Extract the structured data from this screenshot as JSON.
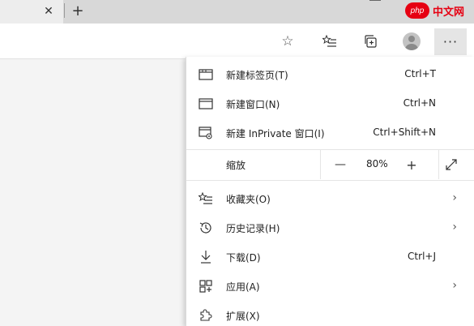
{
  "tabstrip": {
    "close_glyph": "✕",
    "newtab_glyph": "+"
  },
  "watermark": {
    "badge": "php",
    "text": "中文网"
  },
  "toolbar": {
    "more_glyph": "···",
    "star_glyph": "☆"
  },
  "menu": {
    "items": [
      {
        "label": "新建标签页(T)",
        "shortcut": "Ctrl+T",
        "icon": "new-tab-icon"
      },
      {
        "label": "新建窗口(N)",
        "shortcut": "Ctrl+N",
        "icon": "new-window-icon"
      },
      {
        "label": "新建 InPrivate 窗口(I)",
        "shortcut": "Ctrl+Shift+N",
        "icon": "inprivate-window-icon"
      },
      {
        "label": "收藏夹(O)",
        "shortcut": "",
        "icon": "favorites-icon",
        "submenu": true
      },
      {
        "label": "历史记录(H)",
        "shortcut": "",
        "icon": "history-icon",
        "submenu": true
      },
      {
        "label": "下载(D)",
        "shortcut": "Ctrl+J",
        "icon": "download-icon"
      },
      {
        "label": "应用(A)",
        "shortcut": "",
        "icon": "apps-icon",
        "submenu": true
      },
      {
        "label": "扩展(X)",
        "shortcut": "",
        "icon": "extensions-icon"
      }
    ],
    "zoom": {
      "label": "缩放",
      "minus": "—",
      "value": "80%",
      "plus": "+"
    },
    "arrow_glyph": "›"
  },
  "colors": {
    "tabstrip_bg": "#d8d8d8",
    "toolbar_bg": "#ffffff",
    "menu_bg": "#ffffff",
    "watermark_red": "#e60012"
  }
}
